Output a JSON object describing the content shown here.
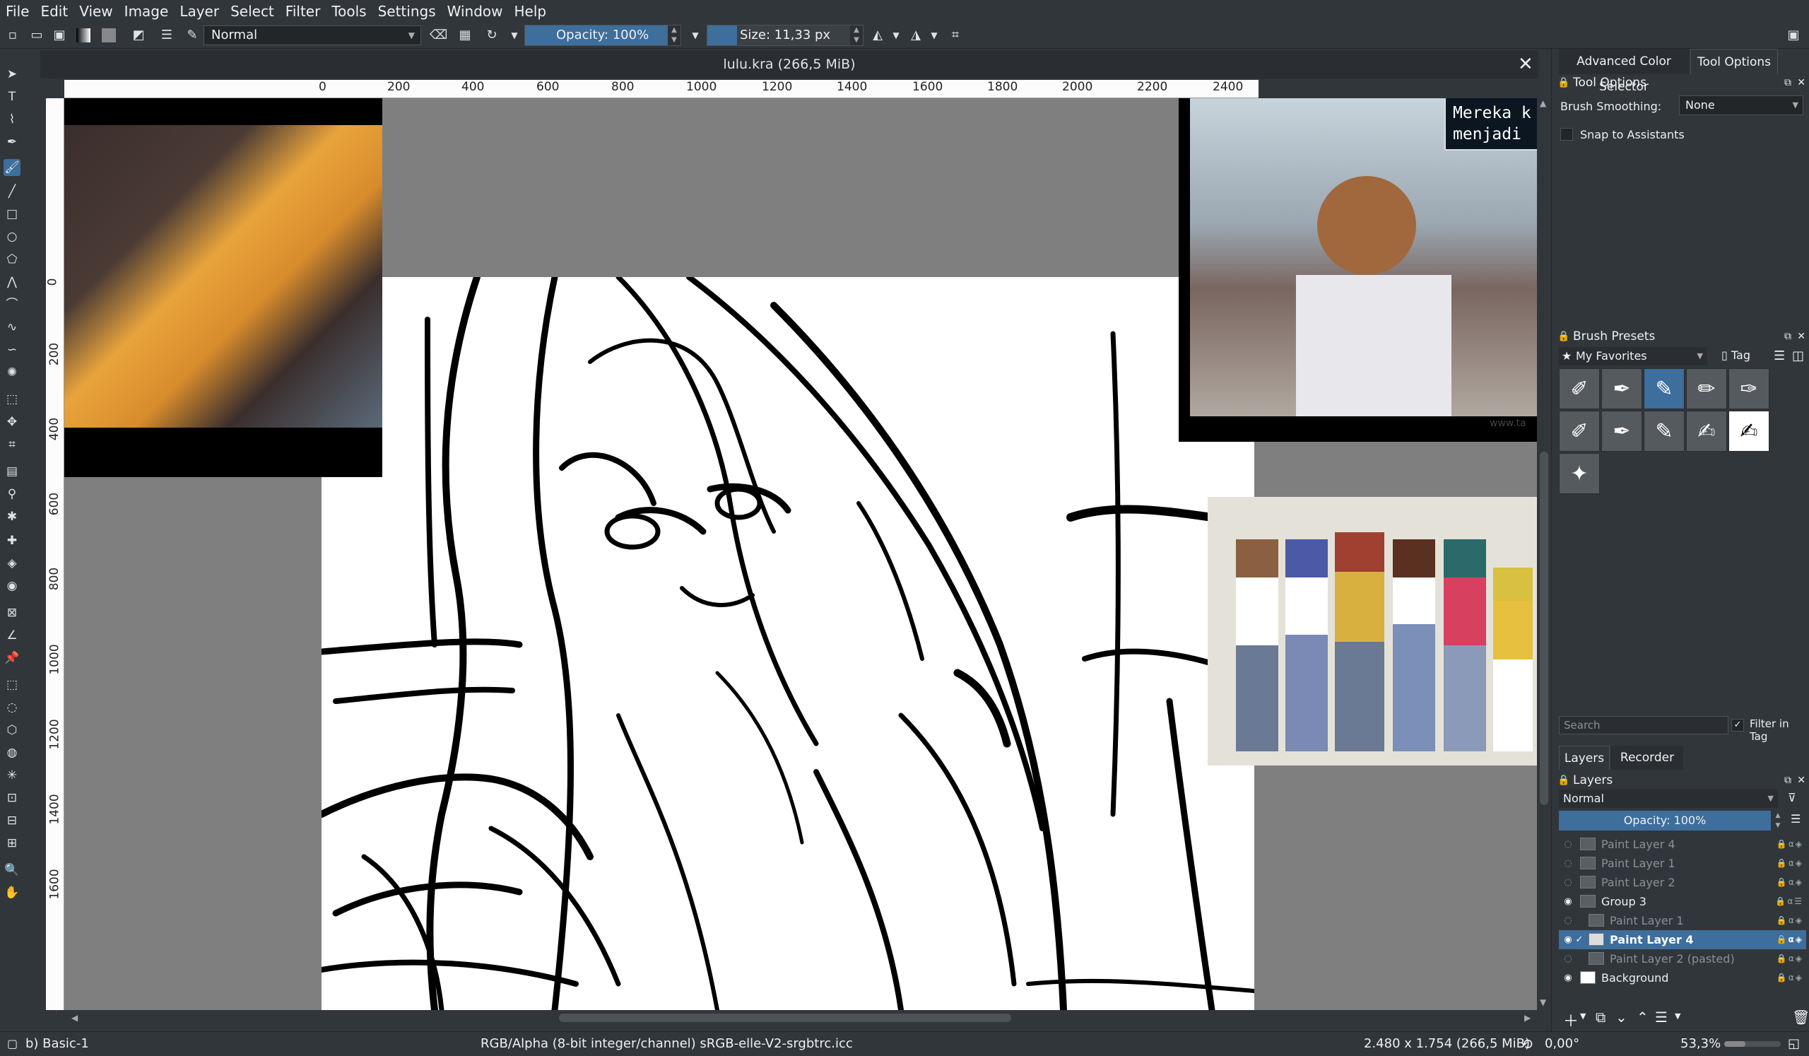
{
  "menu": [
    "File",
    "Edit",
    "View",
    "Image",
    "Layer",
    "Select",
    "Filter",
    "Tools",
    "Settings",
    "Window",
    "Help"
  ],
  "toolbar": {
    "blend_mode": "Normal",
    "opacity": "Opacity: 100%",
    "size": "Size: 11,33 px"
  },
  "document": {
    "tab_title": "lulu.kra (266,5 MiB)",
    "close": "✕"
  },
  "ruler": {
    "h_ticks": [
      "0",
      "200",
      "400",
      "600",
      "800",
      "1000",
      "1200",
      "1400",
      "1600",
      "1800",
      "2000",
      "2200",
      "2400"
    ],
    "v_ticks": [
      "0",
      "200",
      "400",
      "600",
      "800",
      "1000",
      "1200",
      "1400",
      "1600"
    ]
  },
  "canvas": {
    "speech_line1": "Mereka k",
    "speech_line2": "menjadi",
    "watermark": "www.ta"
  },
  "right_panel": {
    "top_tabs": [
      "Advanced Color Selector",
      "Tool Options"
    ],
    "tool_options": {
      "title": "Tool Options",
      "smoothing_label": "Brush Smoothing:",
      "smoothing_value": "None",
      "snap_label": "Snap to Assistants"
    },
    "brush_presets": {
      "title": "Brush Presets",
      "tag": "My Favorites",
      "tag_button": "Tag",
      "search_placeholder": "Search",
      "filter_label": "Filter in Tag"
    },
    "lower_tabs": [
      "Layers",
      "Recorder"
    ],
    "layers": {
      "title": "Layers",
      "blend": "Normal",
      "opacity": "Opacity:  100%",
      "items": [
        {
          "name": "Paint Layer 4",
          "visible": false,
          "selected": false,
          "indent": 0
        },
        {
          "name": "Paint Layer 1",
          "visible": false,
          "selected": false,
          "indent": 0
        },
        {
          "name": "Paint Layer 2",
          "visible": false,
          "selected": false,
          "indent": 0
        },
        {
          "name": "Group 3",
          "visible": true,
          "selected": false,
          "indent": 0
        },
        {
          "name": "Paint Layer 1",
          "visible": false,
          "selected": false,
          "indent": 1
        },
        {
          "name": "Paint Layer 4",
          "visible": true,
          "selected": true,
          "indent": 1
        },
        {
          "name": "Paint Layer 2 (pasted)",
          "visible": false,
          "selected": false,
          "indent": 1
        },
        {
          "name": "Background",
          "visible": true,
          "selected": false,
          "indent": 0
        }
      ]
    }
  },
  "statusbar": {
    "brush": "b) Basic-1",
    "color_model": "RGB/Alpha (8-bit integer/channel)  sRGB-elle-V2-srgbtrc.icc",
    "image_size": "2.480 x 1.754 (266,5 MiB)",
    "rotation": "0,00°",
    "zoom": "53,3%"
  },
  "colors": {
    "accent": "#3d6e9c",
    "panel": "#31363b",
    "canvas_bg": "#7f7f7f"
  }
}
